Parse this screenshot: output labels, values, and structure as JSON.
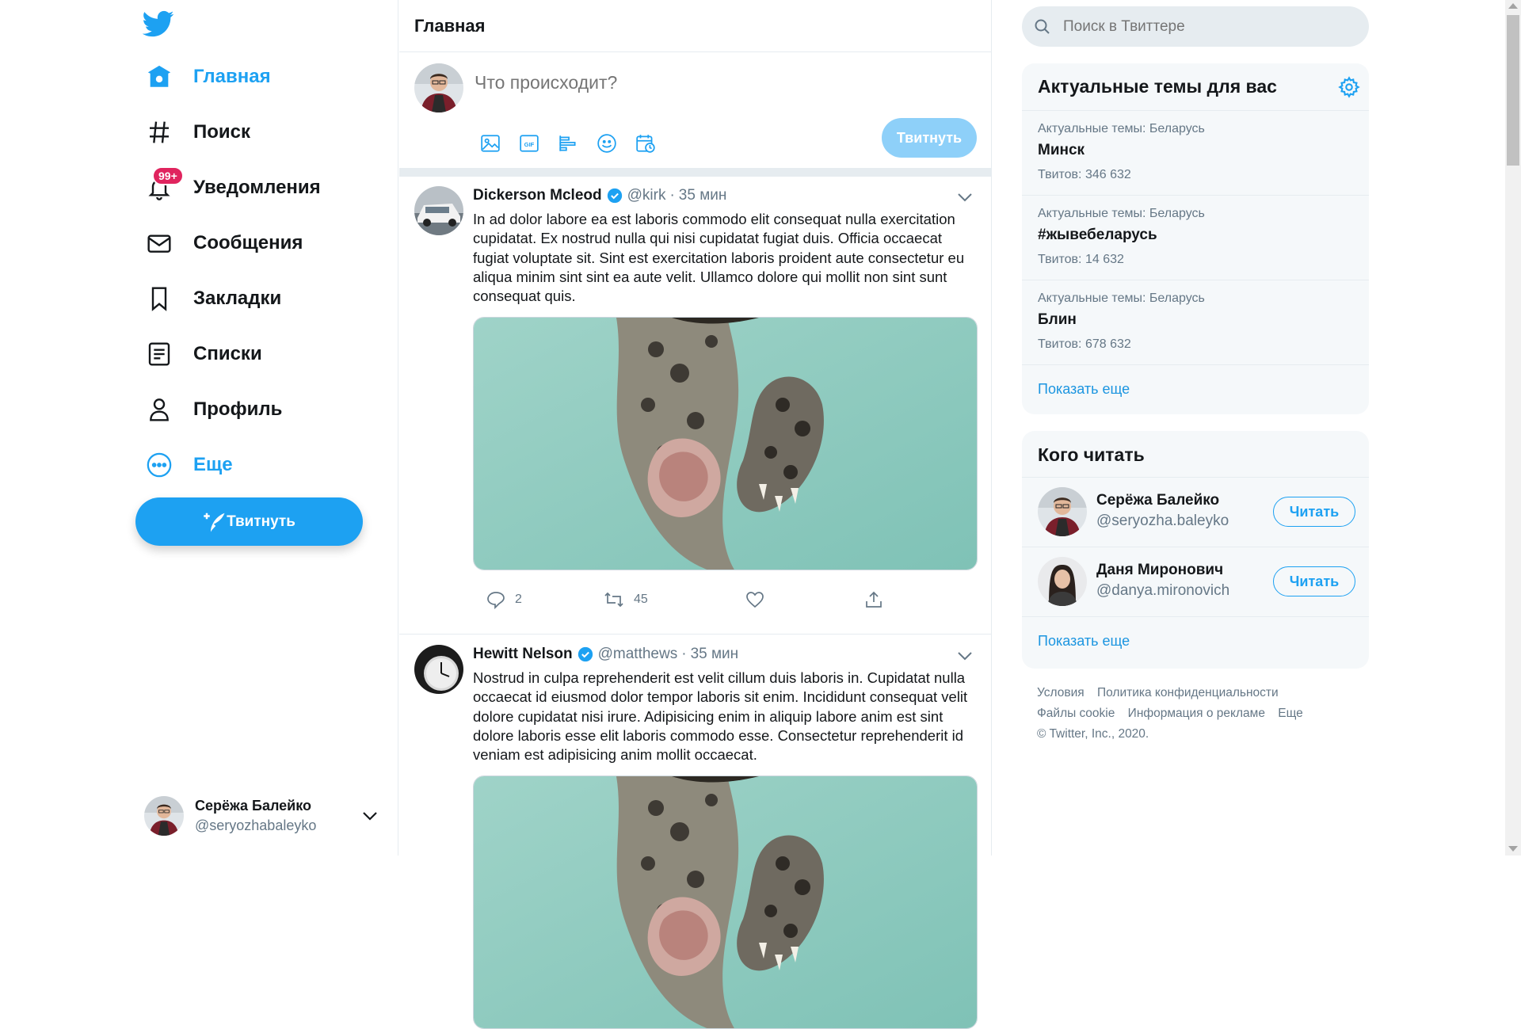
{
  "colors": {
    "accent": "#1da1f2",
    "text": "#14171a",
    "muted": "#657786",
    "border": "#e6ecf0",
    "badge": "#e0245e"
  },
  "sidebar": {
    "logo": "twitter-bird-icon",
    "items": [
      {
        "label": "Главная",
        "icon": "home-icon",
        "active": true
      },
      {
        "label": "Поиск",
        "icon": "hashtag-icon"
      },
      {
        "label": "Уведомления",
        "icon": "bell-icon",
        "badge": "99+"
      },
      {
        "label": "Сообщения",
        "icon": "envelope-icon"
      },
      {
        "label": "Закладки",
        "icon": "bookmark-icon"
      },
      {
        "label": "Списки",
        "icon": "list-icon"
      },
      {
        "label": "Профиль",
        "icon": "person-icon"
      },
      {
        "label": "Еще",
        "icon": "more-circle-icon"
      }
    ],
    "tweet_button": "Твитнуть",
    "account": {
      "name": "Серёжа Балейко",
      "handle": "@seryozhabaleyko"
    }
  },
  "main": {
    "title": "Главная",
    "compose": {
      "placeholder": "Что происходит?",
      "button": "Твитнуть"
    },
    "tweets": [
      {
        "name": "Dickerson Mcleod",
        "handle": "@kirk",
        "dot": "·",
        "time": "35 мин",
        "text": "In ad dolor labore ea est laboris commodo elit consequat nulla exercitation cupidatat. Ex nostrud nulla qui nisi cupidatat fugiat duis. Officia occaecat fugiat voluptate sit. Sint est exercitation laboris proident aute consectetur eu aliqua minim sint sint ea aute velit. Ullamco dolore qui mollit non sint sunt consequat quis.",
        "replies": "2",
        "retweets": "45"
      },
      {
        "name": "Hewitt Nelson",
        "handle": "@matthews",
        "dot": "·",
        "time": "35 мин",
        "text": "Nostrud in culpa reprehenderit est velit cillum duis laboris in. Cupidatat nulla occaecat id eiusmod dolor tempor laboris sit enim. Incididunt consequat velit dolore cupidatat nisi irure. Adipisicing enim in aliquip labore anim est sint dolore laboris esse elit laboris commodo esse. Consectetur reprehenderit id veniam est adipisicing anim mollit occaecat."
      }
    ]
  },
  "right": {
    "search_placeholder": "Поиск в Твиттере",
    "trends": {
      "title": "Актуальные темы для вас",
      "items": [
        {
          "context": "Актуальные темы: Беларусь",
          "name": "Минск",
          "count": "Твитов: 346 632"
        },
        {
          "context": "Актуальные темы: Беларусь",
          "name": "#жывебеларусь",
          "count": "Твитов: 14 632"
        },
        {
          "context": "Актуальные темы: Беларусь",
          "name": "Блин",
          "count": "Твитов: 678 632"
        }
      ],
      "more": "Показать еще"
    },
    "who_to_follow": {
      "title": "Кого читать",
      "items": [
        {
          "name": "Серёжа Балейко",
          "handle": "@seryozha.baleyko",
          "button": "Читать"
        },
        {
          "name": "Даня Миронович",
          "handle": "@danya.mironovich",
          "button": "Читать"
        }
      ],
      "more": "Показать еще"
    },
    "footer": {
      "links": [
        "Условия",
        "Политика конфиденциальности",
        "Файлы cookie",
        "Информация о рекламе",
        "Еще"
      ],
      "copyright": "© Twitter, Inc., 2020."
    }
  }
}
